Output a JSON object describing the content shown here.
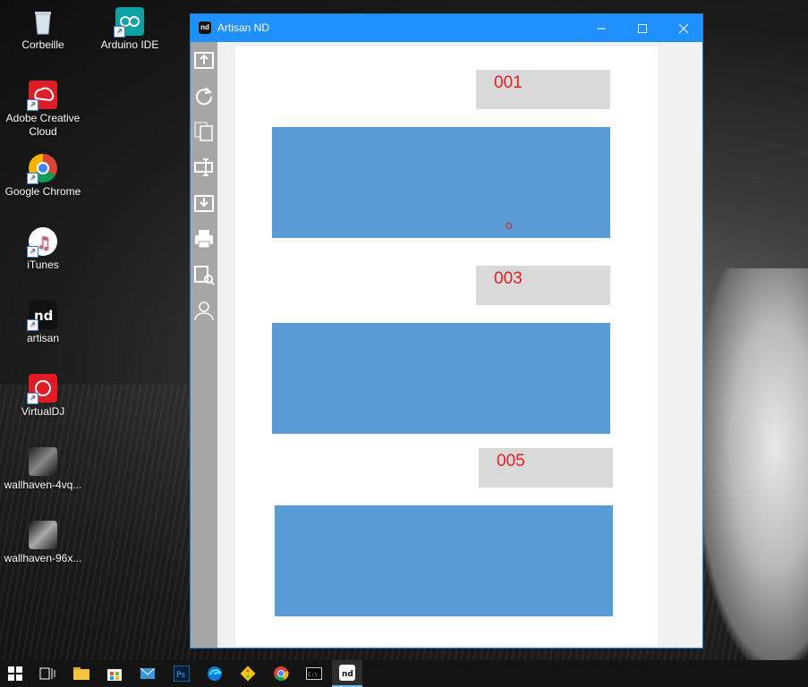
{
  "desktop": {
    "icons": [
      {
        "label": "Corbeille",
        "icon": "recycle-bin-icon"
      },
      {
        "label": "Arduino IDE",
        "icon": "arduino-icon"
      },
      {
        "label": "Adobe Creative Cloud",
        "icon": "creative-cloud-icon"
      },
      {
        "label": "Google Chrome",
        "icon": "chrome-icon"
      },
      {
        "label": "iTunes",
        "icon": "itunes-icon"
      },
      {
        "label": "artisan",
        "icon": "artisan-icon"
      },
      {
        "label": "VirtualDJ",
        "icon": "virtualdj-icon"
      },
      {
        "label": "wallhaven-4vq...",
        "icon": "image-file-icon"
      },
      {
        "label": "wallhaven-96x...",
        "icon": "image-file-icon"
      }
    ]
  },
  "window": {
    "title": "Artisan ND",
    "logo_text": "nd",
    "controls": [
      "minimize-icon",
      "maximize-icon",
      "close-icon"
    ],
    "toolbar": [
      "export-icon",
      "refresh-icon",
      "copy-pages-icon",
      "text-field-icon",
      "download-icon",
      "print-icon",
      "print-preview-icon",
      "user-icon"
    ],
    "labels": [
      "001",
      "003",
      "005"
    ]
  },
  "taskbar": {
    "items": [
      "start-icon",
      "task-view-icon",
      "file-explorer-icon",
      "store-icon",
      "mail-icon",
      "photoshop-icon",
      "edge-icon",
      "git-icon",
      "chrome-icon",
      "terminal-icon",
      "artisan-icon"
    ],
    "active": "artisan-icon"
  },
  "colors": {
    "accent": "#1e90ff",
    "block": "#5b9bd5",
    "label_bg": "#d9d9d9",
    "label_text": "#e31e24"
  }
}
